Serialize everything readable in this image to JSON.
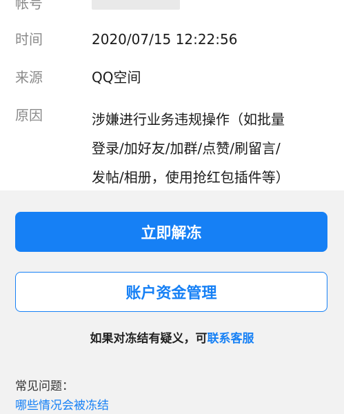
{
  "account_info": {
    "account_label": "帐号",
    "time_label": "时间",
    "time_value": "2020/07/15  12:22:56",
    "source_label": "来源",
    "source_value": "QQ空间",
    "reason_label": "原因",
    "reason_value": "涉嫌进行业务违规操作（如批量\n登录/加好友/加群/点赞/刷留言/\n发帖/相册，使用抢红包插件等）"
  },
  "actions": {
    "unfreeze_label": "立即解冻",
    "fund_management_label": "账户资金管理"
  },
  "help": {
    "question_prefix": "如果对冻结有疑义，可",
    "contact_link": "联系客服"
  },
  "faq": {
    "title": "常见问题：",
    "item_1": "哪些情况会被冻结"
  },
  "colors": {
    "accent": "#1680f5",
    "background": "#f2f2f2",
    "card": "#ffffff"
  }
}
